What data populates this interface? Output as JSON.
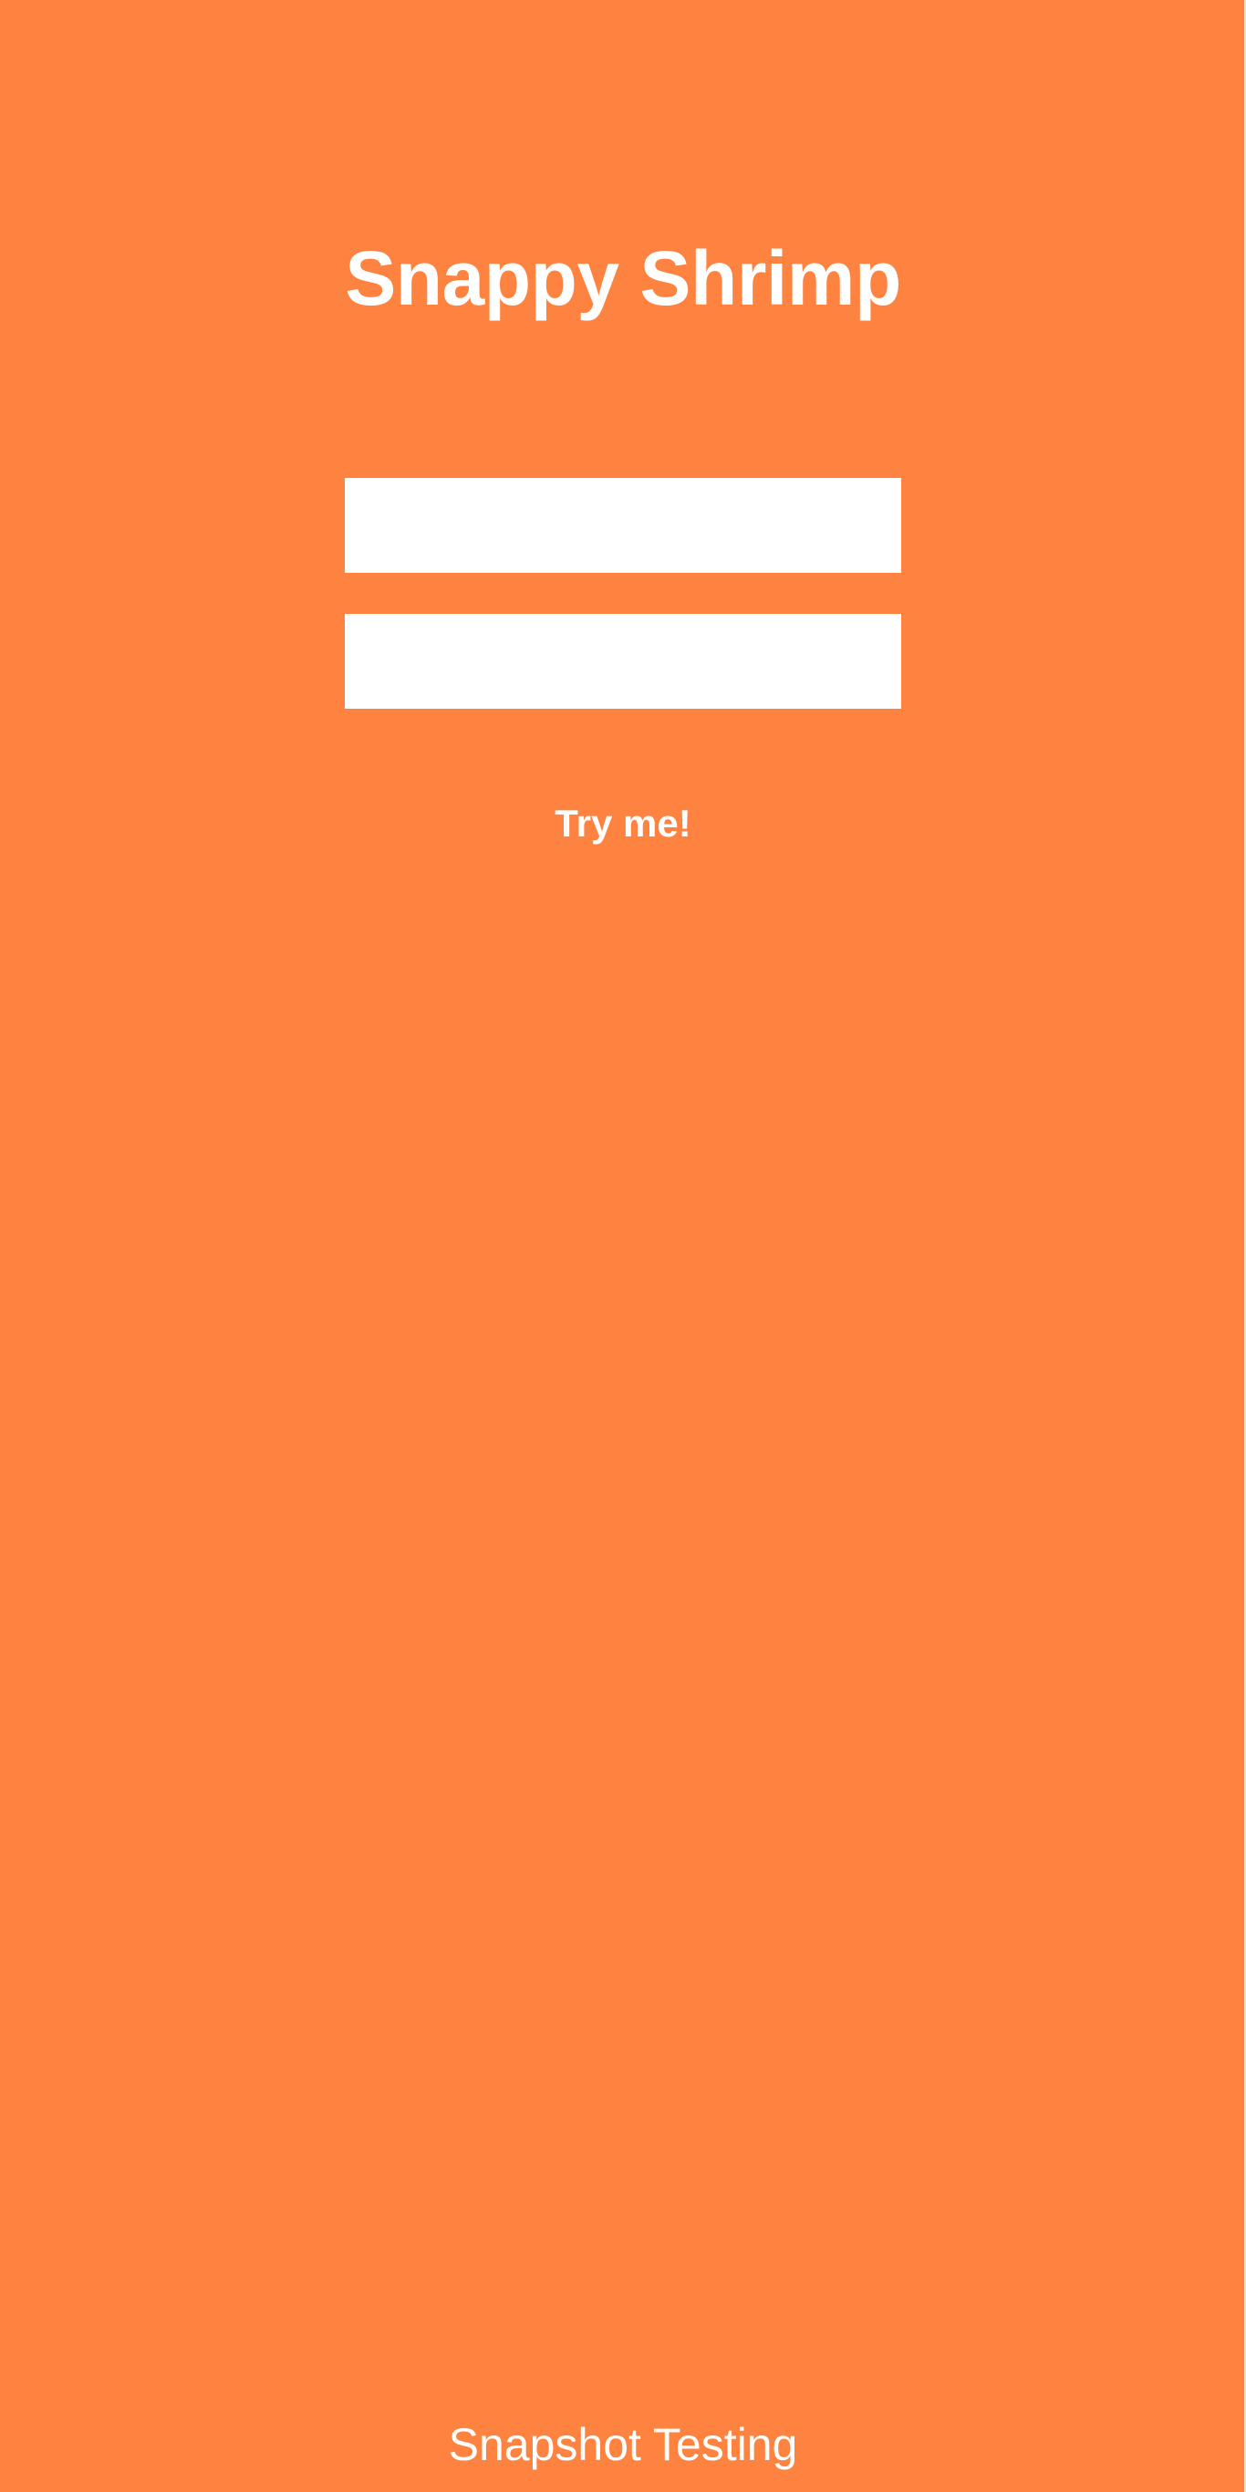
{
  "app": {
    "title": "Snappy Shrimp",
    "background_color": "#ff8340",
    "text_color": "#ffffff"
  },
  "form": {
    "username_value": "",
    "password_value": "",
    "submit_label": "Try me!"
  },
  "footer": {
    "label": "Snapshot Testing"
  }
}
